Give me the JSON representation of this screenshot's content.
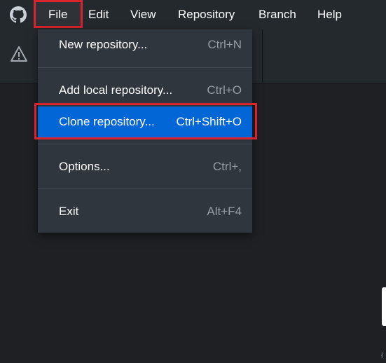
{
  "menubar": {
    "items": [
      "File",
      "Edit",
      "View",
      "Repository",
      "Branch",
      "Help"
    ]
  },
  "file_menu": {
    "items": [
      {
        "label": "New repository...",
        "shortcut": "Ctrl+N"
      },
      {
        "label": "Add local repository...",
        "shortcut": "Ctrl+O"
      },
      {
        "label": "Clone repository...",
        "shortcut": "Ctrl+Shift+O",
        "selected": true
      },
      {
        "label": "Options...",
        "shortcut": "Ctrl+,"
      },
      {
        "label": "Exit",
        "shortcut": "Alt+F4"
      }
    ]
  },
  "corner_text": "ł",
  "colors": {
    "menubar_bg": "#24292e",
    "dropdown_bg": "#2f363d",
    "selected_bg": "#0366d6",
    "highlight_border": "#d9232d"
  },
  "icons": {
    "app": "github-icon",
    "toolbar": "warning-icon"
  }
}
